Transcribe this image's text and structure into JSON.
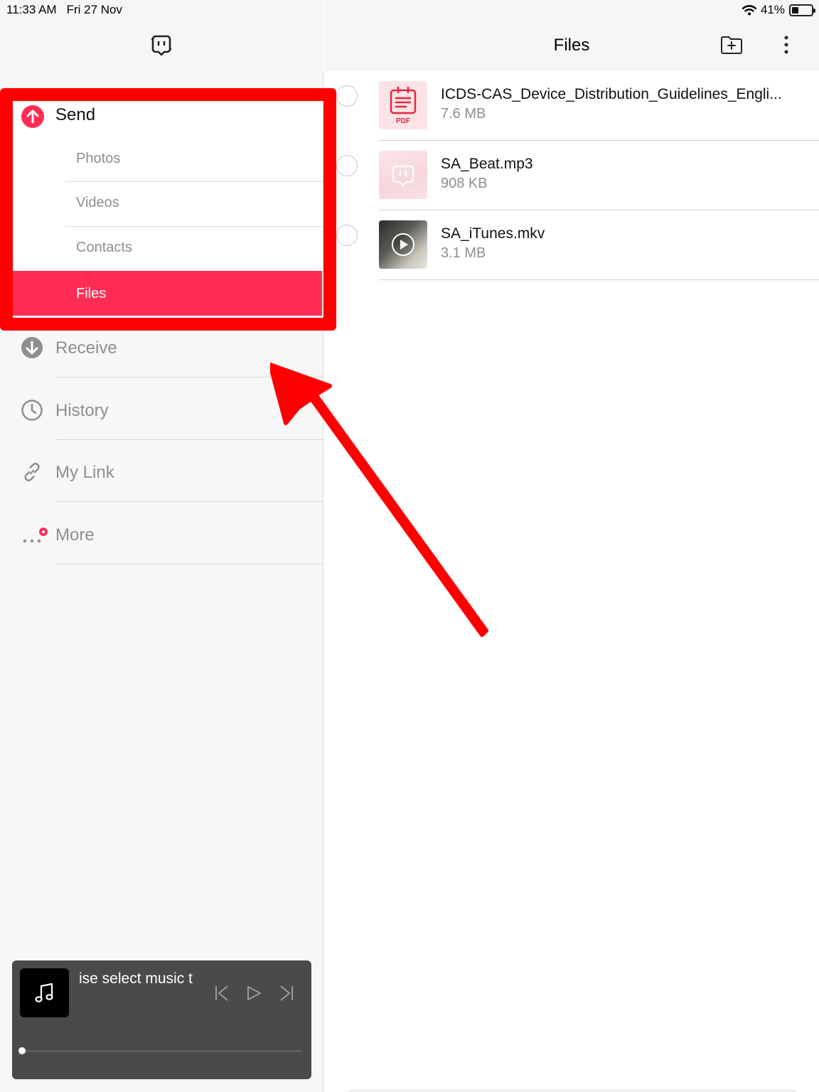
{
  "status_bar": {
    "time": "11:33 AM",
    "date": "Fri 27 Nov",
    "battery": "41%"
  },
  "sidebar": {
    "send": {
      "label": "Send",
      "items": [
        {
          "label": "Photos"
        },
        {
          "label": "Videos"
        },
        {
          "label": "Contacts"
        },
        {
          "label": "Files",
          "selected": true
        }
      ]
    },
    "nav": [
      {
        "label": "Receive",
        "icon": "download-circle-icon"
      },
      {
        "label": "History",
        "icon": "clock-icon"
      },
      {
        "label": "My Link",
        "icon": "link-icon"
      },
      {
        "label": "More",
        "icon": "ellipsis-icon",
        "badge": true
      }
    ]
  },
  "player": {
    "title": "ise select music t",
    "progress": 0
  },
  "main": {
    "title": "Files",
    "files": [
      {
        "name": "ICDS-CAS_Device_Distribution_Guidelines_Engli...",
        "size": "7.6 MB",
        "type_label": "PDF"
      },
      {
        "name": "SA_Beat.mp3",
        "size": "908 KB"
      },
      {
        "name": "SA_iTunes.mkv",
        "size": "3.1 MB"
      }
    ]
  },
  "colors": {
    "accent": "#ff2d55",
    "annotation": "#ff0000"
  }
}
